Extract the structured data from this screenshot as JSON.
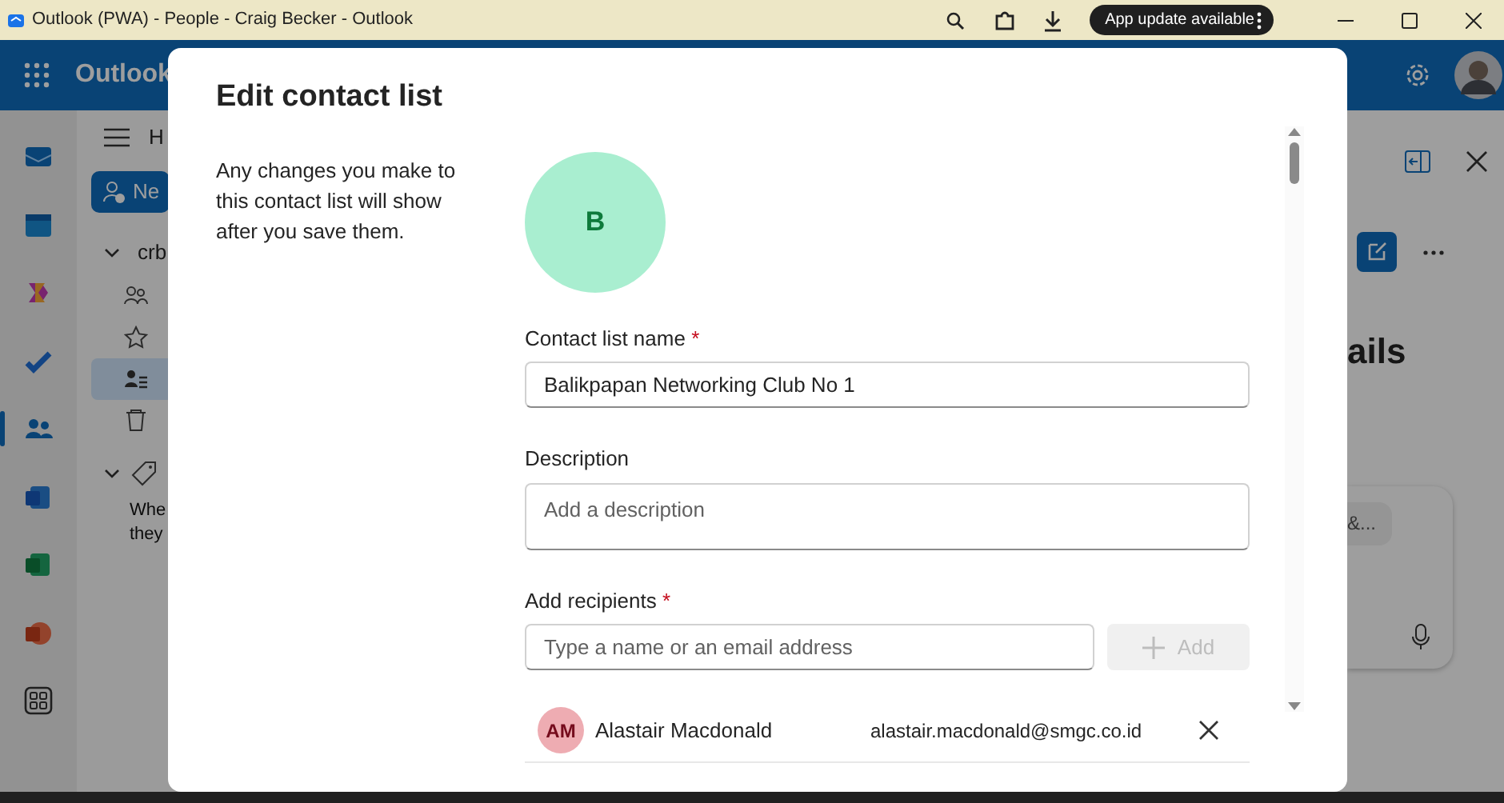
{
  "window": {
    "title": "Outlook (PWA) - People - Craig Becker - Outlook",
    "update_button": "App update available"
  },
  "app": {
    "name": "Outlook",
    "tab_partial": "H",
    "new_button": "Ne",
    "folder": "crb",
    "rail_items": [
      {
        "kind": "mail",
        "selected": false
      },
      {
        "kind": "calendar",
        "selected": false
      },
      {
        "kind": "copilot",
        "selected": false
      },
      {
        "kind": "todo",
        "selected": false
      },
      {
        "kind": "people",
        "selected": true
      },
      {
        "kind": "word",
        "selected": false
      },
      {
        "kind": "excel",
        "selected": false
      },
      {
        "kind": "powerpoint",
        "selected": false
      },
      {
        "kind": "apps",
        "selected": false
      }
    ],
    "nav_items": [
      {
        "kind": "contacts",
        "selected": false
      },
      {
        "kind": "favorites",
        "selected": false
      },
      {
        "kind": "lists",
        "selected": true
      },
      {
        "kind": "deleted",
        "selected": false
      }
    ],
    "hint_lines": [
      "Whe",
      "they"
    ],
    "details_heading": "ails",
    "chip": "&..."
  },
  "dialog": {
    "title": "Edit contact list",
    "intro": "Any changes you make to this contact list will show after you save them.",
    "avatar_letter": "B",
    "required_mark": "*",
    "fields": [
      {
        "kind": "text",
        "label": "Contact list name",
        "required": true,
        "value": "Balikpapan Networking Club No 1"
      },
      {
        "kind": "textarea",
        "label": "Description",
        "required": false,
        "placeholder": "Add a description"
      },
      {
        "kind": "recipients",
        "label": "Add recipients",
        "required": true,
        "placeholder": "Type a name or an email address"
      }
    ],
    "add_button": {
      "label": "Add",
      "disabled": true
    },
    "recipients": [
      {
        "initials": "AM",
        "name": "Alastair Macdonald",
        "email": "alastair.macdonald@smgc.co.id"
      }
    ]
  }
}
